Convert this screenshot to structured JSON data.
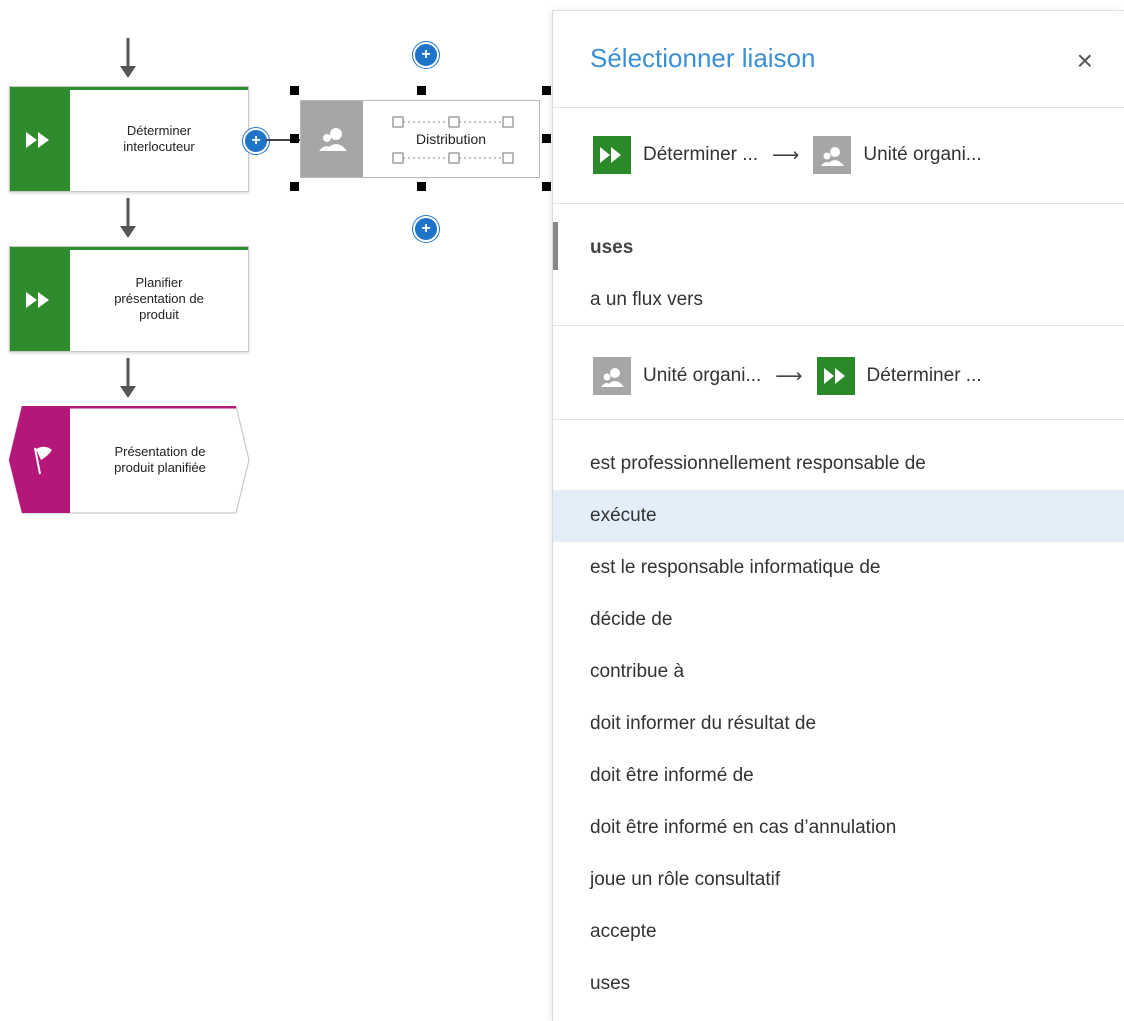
{
  "canvas": {
    "steps": [
      {
        "label": "Déterminer\ninterlocuteur"
      },
      {
        "label": "Planifier\nprésentation de\nproduit"
      }
    ],
    "event": {
      "label": "Présentation de\nproduit planifiée"
    },
    "org_unit": {
      "label": "Distribution"
    },
    "plus_symbol": "+"
  },
  "panel": {
    "title": "Sélectionner liaison",
    "close_label": "×",
    "groups": [
      {
        "from_label": "Déterminer ...",
        "arrow": "⟶",
        "to_label": "Unité organi...",
        "options": [
          "uses",
          "a un flux vers"
        ],
        "selected": "uses"
      },
      {
        "from_label": "Unité organi...",
        "arrow": "⟶",
        "to_label": "Déterminer ...",
        "options": [
          "est professionnellement responsable de",
          "exécute",
          "est le responsable informatique de",
          "décide de",
          "contribue à",
          "doit informer du résultat de",
          "doit être informé de",
          "doit être informé en cas d’annulation",
          "joue un rôle consultatif",
          "accepte",
          "uses"
        ],
        "hovered": "exécute"
      }
    ]
  },
  "colors": {
    "function_green": "#2e8b2e",
    "event_magenta": "#b5167a",
    "org_gray": "#a6a6a6",
    "accent_blue": "#3a8fd8",
    "plus_blue": "#1e74c8",
    "hover_bg": "#e4eef8"
  },
  "icons": {
    "function": "double-chevron-right-icon",
    "event": "flag-icon",
    "org_unit": "group-people-icon",
    "add": "plus-circle-icon",
    "close": "close-icon"
  }
}
